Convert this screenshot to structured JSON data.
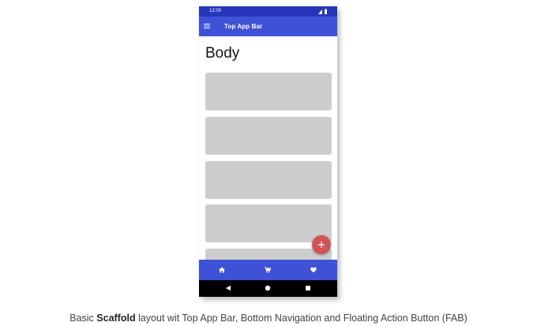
{
  "status_bar": {
    "time": "12:00",
    "icons": [
      "signal-icon",
      "battery-icon"
    ]
  },
  "top_app_bar": {
    "title": "Top App Bar",
    "nav_icon": "menu-icon",
    "color": "#3f51d6"
  },
  "body": {
    "title": "Body",
    "card_count": 5,
    "card_color": "#cdcdcd"
  },
  "fab": {
    "icon": "add-icon",
    "color": "#cf5457"
  },
  "bottom_navigation": {
    "items": [
      {
        "icon": "home-icon"
      },
      {
        "icon": "cart-icon"
      },
      {
        "icon": "heart-icon"
      }
    ],
    "color": "#3f51d6"
  },
  "system_navigation": {
    "buttons": [
      "back-icon",
      "home-circle-icon",
      "recents-icon"
    ]
  },
  "caption": {
    "prefix": "Basic ",
    "bold": "Scaffold",
    "suffix": " layout wit Top App Bar, Bottom Navigation and Floating Action Button (FAB)"
  }
}
